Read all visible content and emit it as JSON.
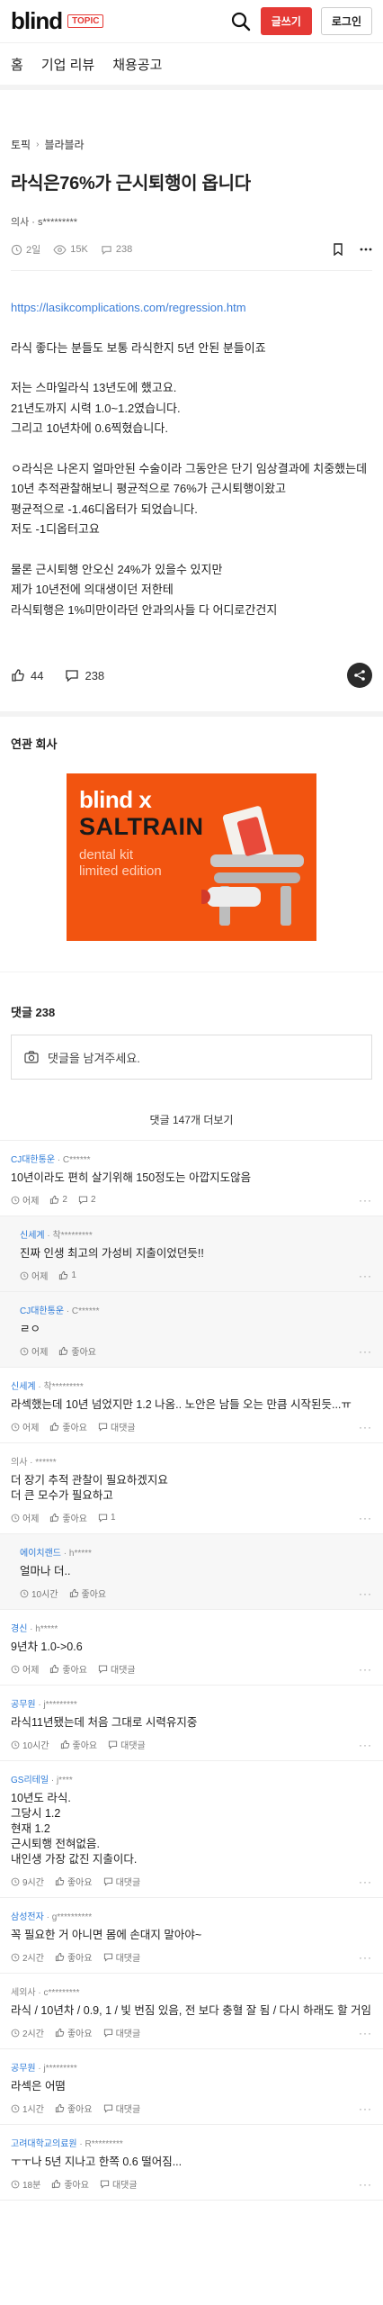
{
  "header": {
    "logo": "blind",
    "badge": "TOPIC",
    "write_label": "글쓰기",
    "login_label": "로그인"
  },
  "nav": [
    "홈",
    "기업 리뷰",
    "채용공고"
  ],
  "post": {
    "breadcrumb": [
      "토픽",
      "블라블라"
    ],
    "title": "라식은76%가 근시퇴행이 옵니다",
    "author": "의사 · s*********",
    "stats": {
      "time": "2일",
      "views": "15K",
      "comments": "238"
    },
    "link": "https://lasikcomplications.com/regression.htm",
    "paragraphs": [
      "라식 좋다는 분들도 보통 라식한지 5년 안된 분들이죠",
      "",
      "저는 스마일라식 13년도에 했고요.",
      "21년도까지 시력 1.0~1.2였습니다.",
      "그리고 10년차에 0.6찍혔습니다.",
      "",
      "ㅇ라식은 나온지 얼마안된 수술이라 그동안은 단기 임상결과에 치중했는데",
      "10년 추적관찰해보니 평균적으로 76%가 근시퇴행이왔고",
      "평균적으로 -1.46디옵터가 되었습니다.",
      "저도 -1디옵터고요",
      "",
      "물론 근시퇴행 안오신 24%가 있을수 있지만",
      "제가 10년전에 의대생이던 저한테",
      "라식퇴행은 1%미만이라던 안과의사들 다 어디로간건지"
    ],
    "likes": "44",
    "comment_count": "238"
  },
  "related": {
    "title": "연관 회사",
    "ad": {
      "line1": "blind x",
      "line2": "SALTRAIN",
      "line3": "dental kit",
      "line4": "limited edition"
    }
  },
  "comments_section": {
    "title": "댓글 238",
    "input_placeholder": "댓글을 남겨주세요.",
    "more_label": "댓글 147개 더보기"
  },
  "comments": [
    {
      "company": "CJ대한통운",
      "user": " · C******",
      "text": "10년이라도 편히 살기위해 150정도는 아깝지도않음",
      "time": "어제",
      "likes": "2",
      "replies": "2",
      "reply": false
    },
    {
      "company": "신세계",
      "user": " · 착*********",
      "text": "진짜 인생 최고의 가성비 지출이었던듯!!",
      "time": "어제",
      "likes": "1",
      "replies": "",
      "reply": true
    },
    {
      "company": "CJ대한통운",
      "user": " · C******",
      "text": "ㄹㅇ",
      "time": "어제",
      "likes": "좋아요",
      "replies": "",
      "reply": true
    },
    {
      "company": "신세계",
      "user": " · 착*********",
      "text": "라섹했는데 10년 넘었지만 1.2 나옴.. 노안은 남들 오는 만큼 시작된듯...ㅠ",
      "time": "어제",
      "likes": "좋아요",
      "replies": "대댓글",
      "reply": false
    },
    {
      "company": "",
      "user": "의사 · ******",
      "text": "더 장기 추적 관찰이 필요하겠지요\n더 큰 모수가 필요하고",
      "time": "어제",
      "likes": "좋아요",
      "replies": "1",
      "reply": false
    },
    {
      "company": "에이치랜드",
      "user": " · h*****",
      "text": "얼마나 더..",
      "time": "10시간",
      "likes": "좋아요",
      "replies": "",
      "reply": true
    },
    {
      "company": "경신",
      "user": " · h*****",
      "text": "9년차 1.0->0.6",
      "time": "어제",
      "likes": "좋아요",
      "replies": "대댓글",
      "reply": false
    },
    {
      "company": "공무원",
      "user": " · j*********",
      "text": "라식11년됐는데 처음 그대로 시력유지중",
      "time": "10시간",
      "likes": "좋아요",
      "replies": "대댓글",
      "reply": false
    },
    {
      "company": "GS리테일",
      "user": " · j****",
      "text": "10년도 라식.\n그당시 1.2\n현재 1.2\n근시퇴행 전혀없음.\n내인생 가장 값진 지출이다.",
      "time": "9시간",
      "likes": "좋아요",
      "replies": "대댓글",
      "reply": false
    },
    {
      "company": "삼성전자",
      "user": " · g**********",
      "text": "꼭 필요한 거 아니면 몸에 손대지 말아야~",
      "time": "2시간",
      "likes": "좋아요",
      "replies": "대댓글",
      "reply": false
    },
    {
      "company": "",
      "user": "세외사 · c*********",
      "text": "라식 / 10년차 / 0.9, 1 / 빛 번짐 있음, 전 보다 충혈 잘 됨 / 다시 하래도 할 거임",
      "time": "2시간",
      "likes": "좋아요",
      "replies": "대댓글",
      "reply": false
    },
    {
      "company": "공무원",
      "user": " · j*********",
      "text": "라섹은 어뗨",
      "time": "1시간",
      "likes": "좋아요",
      "replies": "대댓글",
      "reply": false
    },
    {
      "company": "고려대학교의료원",
      "user": " · R*********",
      "text": "ㅜㅜ나 5년 지나고 한쪽 0.6 떨어짐...",
      "time": "18분",
      "likes": "좋아요",
      "replies": "대댓글",
      "reply": false
    }
  ]
}
